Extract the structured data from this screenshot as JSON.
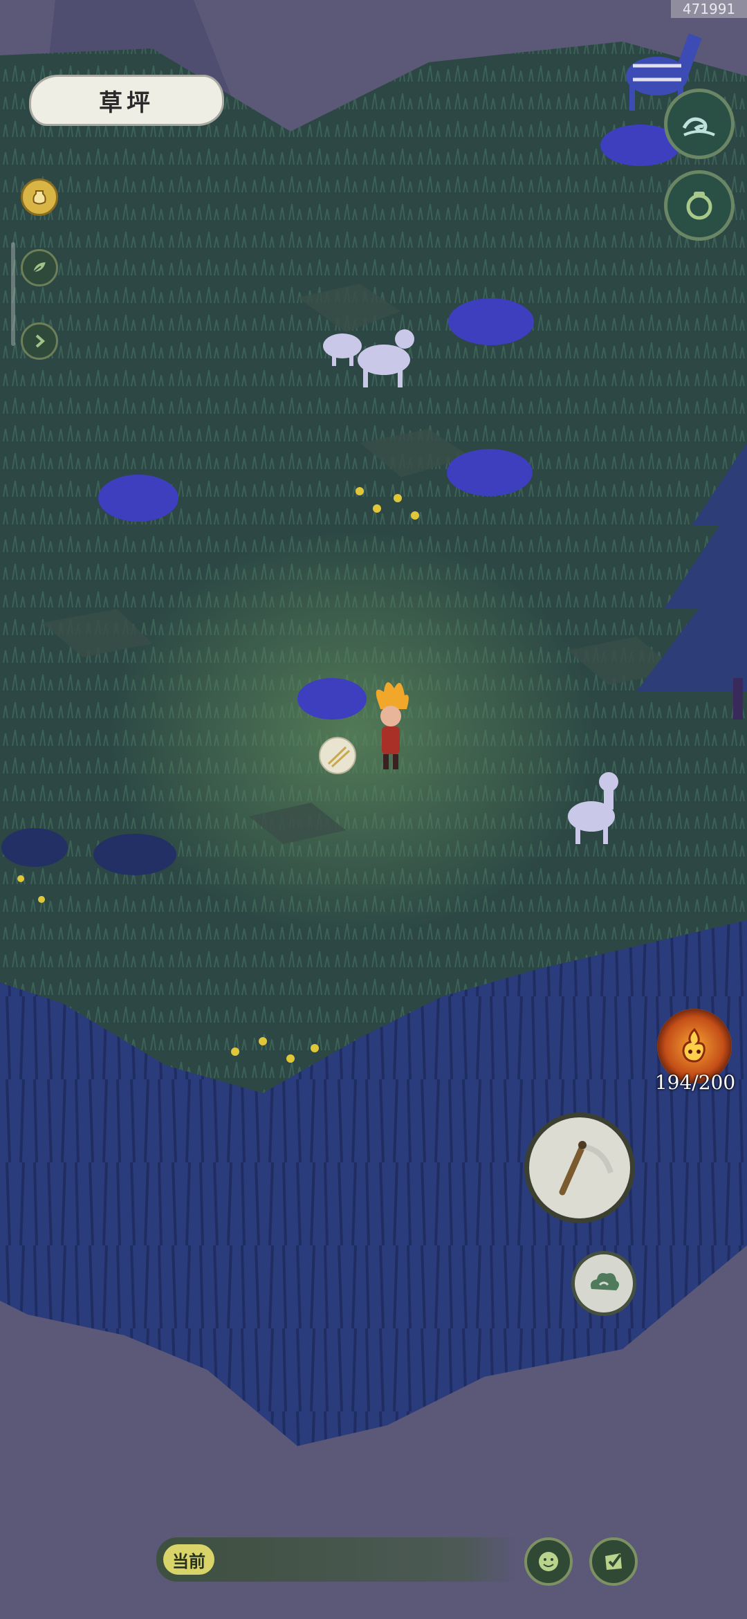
{
  "header": {
    "build_id": "471991",
    "location_name": "草坪"
  },
  "left_menu": {
    "items": [
      {
        "name": "bag",
        "icon": "jar-icon"
      },
      {
        "name": "leaf",
        "icon": "leaf-icon"
      },
      {
        "name": "expand",
        "icon": "chevron-right-icon"
      }
    ]
  },
  "right_menu": {
    "items": [
      {
        "name": "wave",
        "icon": "wave-icon"
      },
      {
        "name": "pot",
        "icon": "pot-icon"
      }
    ]
  },
  "energy": {
    "value": 194,
    "max": 200,
    "text": "194/200"
  },
  "actions": {
    "tool": "sickle-icon",
    "cloud": "cloud-icon"
  },
  "bottom_bar": {
    "current_label": "当前"
  },
  "colors": {
    "grass": "#2e4a45",
    "cliff": "#2a3e7a",
    "sky": "#5b5878",
    "flowers_blue": "#3d3fbf",
    "flowers_yellow": "#e0c73a"
  }
}
